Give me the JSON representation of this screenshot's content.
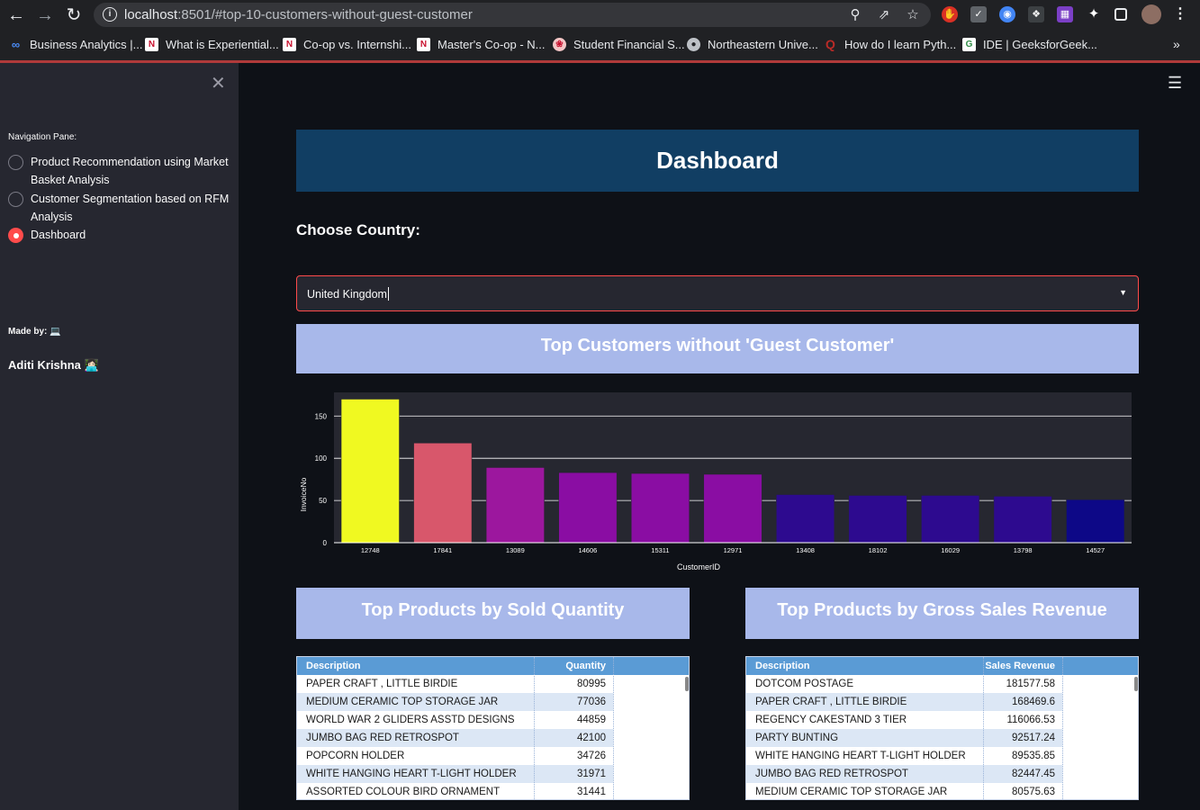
{
  "browser": {
    "url_host": "localhost",
    "url_rest": ":8501/#top-10-customers-without-guest-customer",
    "bookmarks": [
      {
        "label": "Business Analytics |...",
        "icon": "infinity-icon"
      },
      {
        "label": "What is Experiential...",
        "icon": "n-logo-icon"
      },
      {
        "label": "Co-op vs. Internshi...",
        "icon": "n-logo-icon"
      },
      {
        "label": "Master's Co-op - N...",
        "icon": "n-logo-icon"
      },
      {
        "label": "Student Financial S...",
        "icon": "seal-icon"
      },
      {
        "label": "Northeastern Unive...",
        "icon": "globe-icon"
      },
      {
        "label": "How do I learn Pyth...",
        "icon": "quora-icon"
      },
      {
        "label": "IDE | GeeksforGeek...",
        "icon": "gfg-icon"
      }
    ]
  },
  "sidebar": {
    "nav_title": "Navigation Pane:",
    "options": [
      {
        "label": "Product Recommendation using Market Basket Analysis",
        "selected": false
      },
      {
        "label": "Customer Segmentation based on RFM Analysis",
        "selected": false
      },
      {
        "label": "Dashboard",
        "selected": true
      }
    ],
    "made_by": "Made by: 💻",
    "author": "Aditi Krishna 👩🏻‍💻"
  },
  "main": {
    "title": "Dashboard",
    "choose_label": "Choose Country:",
    "country_value": "United Kingdom",
    "chart_title": "Top Customers without 'Guest Customer'",
    "products_qty_title": "Top Products by Sold Quantity",
    "products_rev_title": "Top Products by Gross Sales Revenue"
  },
  "chart_data": {
    "type": "bar",
    "title": "",
    "xlabel": "CustomerID",
    "ylabel": "InvoiceNo",
    "categories": [
      "12748",
      "17841",
      "13089",
      "14606",
      "15311",
      "12971",
      "13408",
      "18102",
      "16029",
      "13798",
      "14527"
    ],
    "values": [
      170,
      118,
      89,
      83,
      82,
      81,
      57,
      56,
      56,
      55,
      51
    ],
    "colors": [
      "#f0f921",
      "#d8576b",
      "#9c179e",
      "#8a0da3",
      "#8a0da3",
      "#8a0da3",
      "#2d0a8f",
      "#2d0a8f",
      "#2d0a8f",
      "#2d0a8f",
      "#0d0887"
    ],
    "ylim": [
      0,
      178
    ],
    "yticks": [
      0,
      50,
      100,
      150
    ],
    "grid": true,
    "background": "#262730"
  },
  "table_qty": {
    "columns": [
      "Description",
      "Quantity"
    ],
    "rows": [
      [
        "PAPER CRAFT , LITTLE BIRDIE",
        "80995"
      ],
      [
        "MEDIUM CERAMIC TOP STORAGE JAR",
        "77036"
      ],
      [
        "WORLD WAR 2 GLIDERS ASSTD DESIGNS",
        "44859"
      ],
      [
        "JUMBO BAG RED RETROSPOT",
        "42100"
      ],
      [
        "POPCORN HOLDER",
        "34726"
      ],
      [
        "WHITE HANGING HEART T-LIGHT HOLDER",
        "31971"
      ],
      [
        "ASSORTED COLOUR BIRD ORNAMENT",
        "31441"
      ]
    ]
  },
  "table_rev": {
    "columns": [
      "Description",
      "Sales Revenue"
    ],
    "rows": [
      [
        "DOTCOM POSTAGE",
        "181577.58"
      ],
      [
        "PAPER CRAFT , LITTLE BIRDIE",
        "168469.6"
      ],
      [
        "REGENCY CAKESTAND 3 TIER",
        "116066.53"
      ],
      [
        "PARTY BUNTING",
        "92517.24"
      ],
      [
        "WHITE HANGING HEART T-LIGHT HOLDER",
        "89535.85"
      ],
      [
        "JUMBO BAG RED RETROSPOT",
        "82447.45"
      ],
      [
        "MEDIUM CERAMIC TOP STORAGE JAR",
        "80575.63"
      ]
    ]
  }
}
